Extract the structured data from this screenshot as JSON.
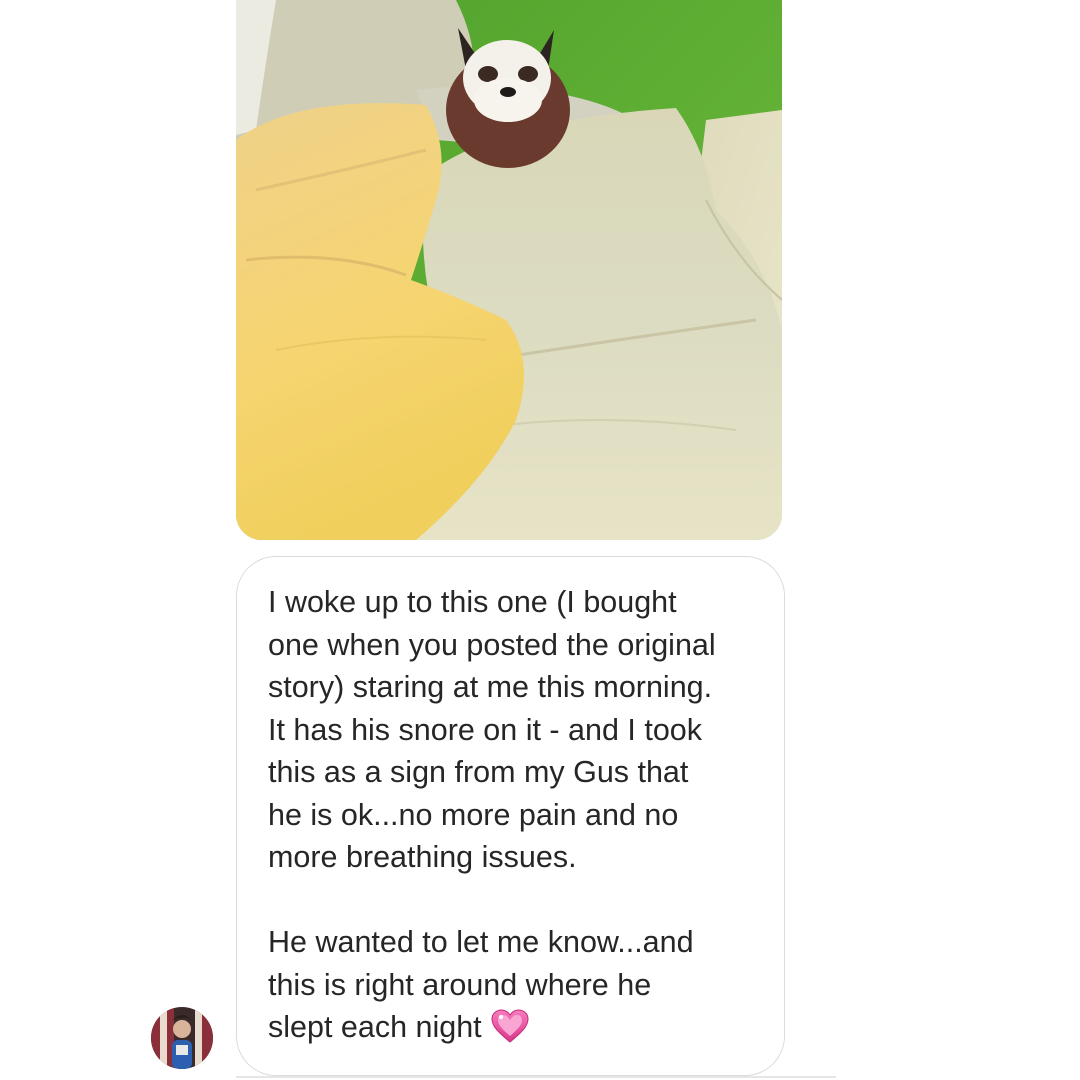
{
  "thread": {
    "photo_message": {
      "icon": "photo-of-plush-dog-on-bed"
    },
    "text_message": {
      "lines": [
        "I woke up to this one (I bought",
        "one when you posted the original",
        "story) staring at me this morning.",
        "It has his snore on it - and I took",
        "this as a sign from my Gus that",
        "he is ok...no more pain and no",
        "more breathing issues."
      ],
      "lines2": [
        "He wanted to let me know...and",
        "this is right around where he",
        "slept each night"
      ],
      "emoji": "sparkling-heart-icon"
    },
    "sender_avatar": {
      "icon": "user-avatar"
    }
  },
  "colors": {
    "bubble_border": "#dbdbdb",
    "text": "#262626",
    "wall_green": "#63b335",
    "heart_pink": "#e8489a"
  }
}
